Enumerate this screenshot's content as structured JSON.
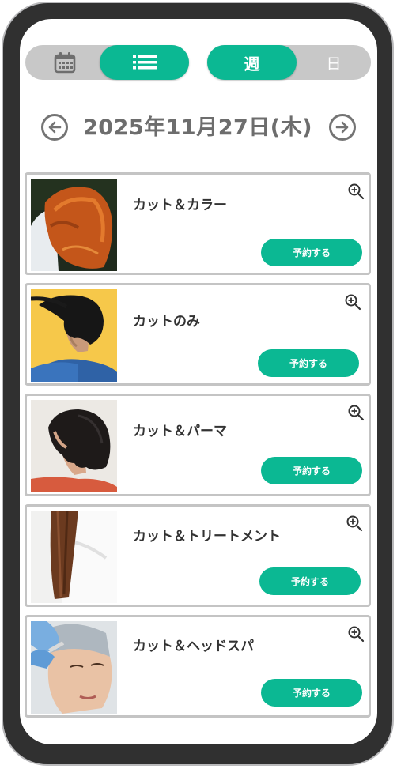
{
  "header": {
    "view_toggle": {
      "calendar_icon": "calendar-icon",
      "list_icon": "list-icon",
      "active": "list"
    },
    "range_toggle": {
      "week_label": "週",
      "day_label": "日",
      "active": "week"
    },
    "date_label": "2025年11月27日(木)",
    "prev_icon": "arrow-left-circle-icon",
    "next_icon": "arrow-right-circle-icon"
  },
  "colors": {
    "accent": "#0bb893",
    "toggle_bg": "#c8c8c8",
    "frame": "#303030"
  },
  "menus": [
    {
      "title": "カット＆カラー",
      "button": "予約する",
      "zoom_icon": "zoom-in-icon"
    },
    {
      "title": "カットのみ",
      "button": "予約する",
      "zoom_icon": "zoom-in-icon"
    },
    {
      "title": "カット＆パーマ",
      "button": "予約する",
      "zoom_icon": "zoom-in-icon"
    },
    {
      "title": "カット＆トリートメント",
      "button": "予約する",
      "zoom_icon": "zoom-in-icon"
    },
    {
      "title": "カット＆ヘッドスパ",
      "button": "予約する",
      "zoom_icon": "zoom-in-icon"
    }
  ]
}
